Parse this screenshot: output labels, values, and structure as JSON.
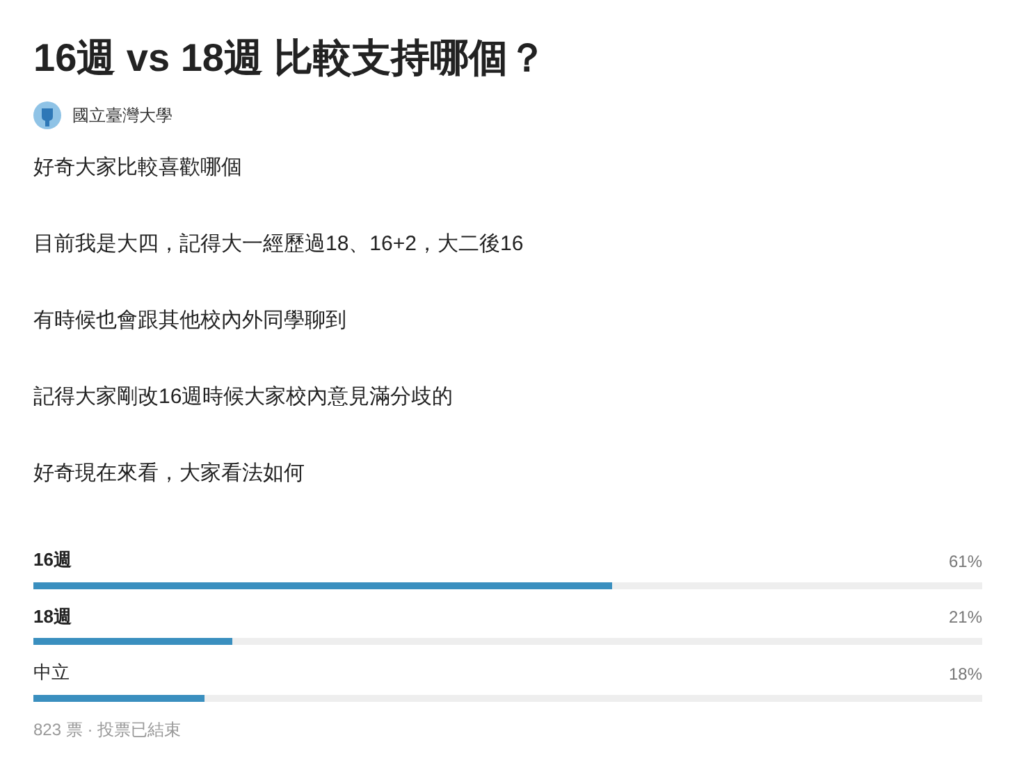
{
  "title": "16週 vs 18週 比較支持哪個？",
  "author": {
    "name": "國立臺灣大學"
  },
  "paragraphs": [
    "好奇大家比較喜歡哪個",
    "目前我是大四，記得大一經歷過18、16+2，大二後16",
    "有時候也會跟其他校內外同學聊到",
    "記得大家剛改16週時候大家校內意見滿分歧的",
    "好奇現在來看，大家看法如何"
  ],
  "poll": {
    "options": [
      {
        "label": "16週",
        "emphasized": true,
        "level": 0.61,
        "reading": "61%"
      },
      {
        "label": "18週",
        "emphasized": true,
        "level": 0.21,
        "reading": "21%"
      },
      {
        "label": "中立",
        "emphasized": false,
        "level": 0.18,
        "reading": "18%"
      }
    ],
    "footer": "823 票 · 投票已結束"
  }
}
